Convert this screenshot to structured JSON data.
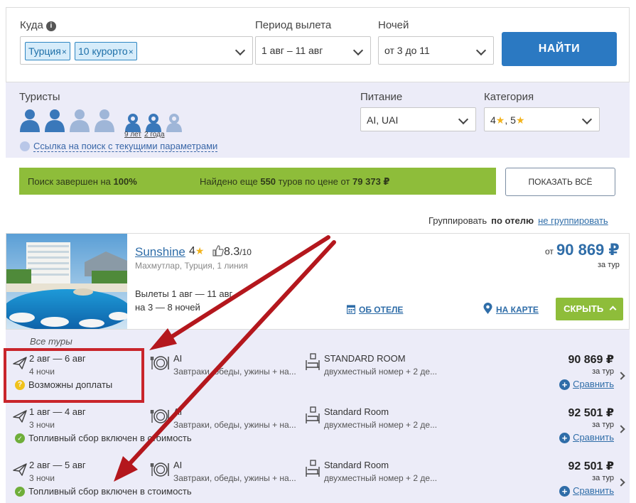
{
  "search": {
    "destination_label": "Куда",
    "tags": [
      "Турция",
      "10 курорто"
    ],
    "tag_close": "×",
    "period_label": "Период вылета",
    "period_value": "1 авг – 11 авг",
    "nights_label": "Ночей",
    "nights_value": "от 3 до 11",
    "find_button": "НАЙТИ"
  },
  "tourists": {
    "label": "Туристы",
    "child_ages": [
      "9 лет",
      "2 года"
    ],
    "search_link": "Ссылка на поиск с текущими параметрами",
    "meal_label": "Питание",
    "meal_value": "AI, UAI",
    "category_label": "Категория",
    "category_values": [
      "4",
      "5"
    ]
  },
  "status": {
    "left_text": "Поиск завершен на ",
    "left_percent": "100%",
    "found_prefix": "Найдено еще ",
    "found_count": "550",
    "found_mid": " туров по цене от ",
    "found_price": "79 373 ₽",
    "show_all_button": "ПОКАЗАТЬ ВСЁ"
  },
  "grouping": {
    "label": "Группировать",
    "option_by_hotel": "по отелю",
    "option_none": "не группировать"
  },
  "hotel": {
    "name": "Sunshine",
    "stars": "4",
    "rating": "8.3",
    "rating_max": "/10",
    "location": "Махмутлар, Турция, 1 линия",
    "dates": "Вылеты 1 авг — 11 авг",
    "nights": "на 3 — 8 ночей",
    "about_link": "ОБ ОТЕЛЕ",
    "map_link": "НА КАРТЕ",
    "hide_button": "СКРЫТЬ",
    "price_from": "от",
    "price": "90 869 ₽",
    "per_tour": "за тур"
  },
  "tours": {
    "title": "Все туры",
    "rows": [
      {
        "dates": "2 авг — 6 авг",
        "nights": "4 ночи",
        "note": "Возможны доплаты",
        "note_type": "warning",
        "meal": "AI",
        "meal_desc": "Завтраки, обеды, ужины + на...",
        "room": "STANDARD ROOM",
        "room_desc": "двухместный номер + 2 де...",
        "price": "90 869 ₽",
        "per_tour": "за тур",
        "compare": "Сравнить"
      },
      {
        "dates": "1 авг — 4 авг",
        "nights": "3 ночи",
        "note": "Топливный сбор включен в стоимость",
        "note_type": "ok",
        "meal": "AI",
        "meal_desc": "Завтраки, обеды, ужины + на...",
        "room": "Standard Room",
        "room_desc": "двухместный номер + 2 де...",
        "price": "92 501 ₽",
        "per_tour": "за тур",
        "compare": "Сравнить"
      },
      {
        "dates": "2 авг — 5 авг",
        "nights": "3 ночи",
        "note": "Топливный сбор включен в стоимость",
        "note_type": "ok",
        "meal": "AI",
        "meal_desc": "Завтраки, обеды, ужины + на...",
        "room": "Standard Room",
        "room_desc": "двухместный номер + 2 де...",
        "price": "92 501 ₽",
        "per_tour": "за тур",
        "compare": "Сравнить"
      }
    ]
  },
  "colors": {
    "accent_blue": "#2b79c2",
    "green": "#8ebd3a",
    "panel_lilac": "#ececf8",
    "annotation_red": "#c9252b",
    "star_yellow": "#f2b31c"
  },
  "icons": [
    "info-icon",
    "adult-icon",
    "child-icon",
    "link-icon",
    "calendar-icon",
    "map-pin-icon",
    "thumbs-up-icon",
    "plane-icon",
    "plate-icon",
    "bed-icon",
    "warning-icon",
    "check-icon",
    "plus-icon",
    "chevron-down-icon",
    "chevron-right-icon",
    "chevron-up-icon"
  ]
}
